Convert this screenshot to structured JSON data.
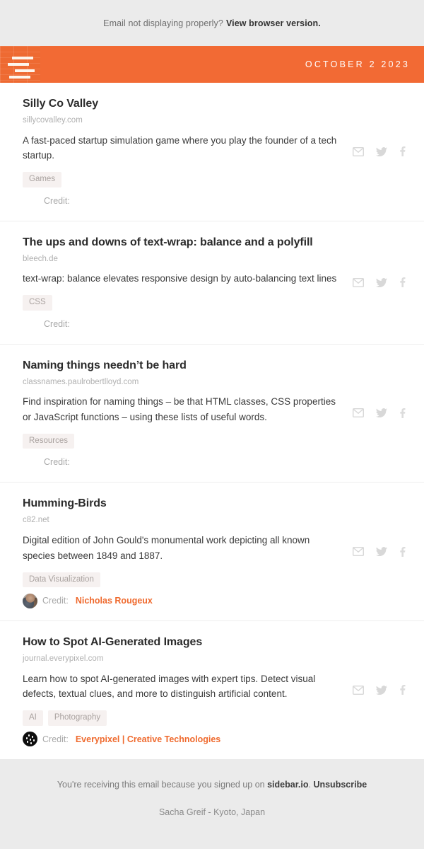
{
  "preheader": {
    "text": "Email not displaying properly?",
    "link_label": "View browser version."
  },
  "masthead": {
    "date": "OCTOBER 2 2023",
    "logo_name": "sidebar-brick-logo",
    "background_color": "#f26a34"
  },
  "social": {
    "email_label": "Share by email",
    "twitter_label": "Share on Twitter",
    "facebook_label": "Share on Facebook"
  },
  "articles": [
    {
      "title": "Silly Co Valley",
      "domain": "sillycovalley.com",
      "description": "A fast-paced startup simulation game where you play the founder of a tech startup.",
      "tags": [
        "Games"
      ],
      "credit_label": "Credit:",
      "credit_name": "",
      "has_avatar": false,
      "avatar_type": ""
    },
    {
      "title": "The ups and downs of text-wrap: balance and a polyfill",
      "domain": "bleech.de",
      "description": "text-wrap: balance elevates responsive design by auto-balancing text lines",
      "tags": [
        "CSS"
      ],
      "credit_label": "Credit:",
      "credit_name": "",
      "has_avatar": false,
      "avatar_type": ""
    },
    {
      "title": "Naming things needn’t be hard",
      "domain": "classnames.paulrobertlloyd.com",
      "description": "Find inspiration for naming things – be that HTML classes, CSS properties or JavaScript functions – using these lists of useful words.",
      "tags": [
        "Resources"
      ],
      "credit_label": "Credit:",
      "credit_name": "",
      "has_avatar": false,
      "avatar_type": ""
    },
    {
      "title": "Humming-Birds",
      "domain": "c82.net",
      "description": "Digital edition of John Gould's monumental work depicting all known species between 1849 and 1887.",
      "tags": [
        "Data Visualization"
      ],
      "credit_label": "Credit:",
      "credit_name": "Nicholas Rougeux",
      "has_avatar": true,
      "avatar_type": "photo"
    },
    {
      "title": "How to Spot AI-Generated Images",
      "domain": "journal.everypixel.com",
      "description": "Learn how to spot AI-generated images with expert tips. Detect visual defects, textual clues, and more to distinguish artificial content.",
      "tags": [
        "AI",
        "Photography"
      ],
      "credit_label": "Credit:",
      "credit_name": "Everypixel | Creative Technologies",
      "has_avatar": true,
      "avatar_type": "dots"
    }
  ],
  "footer": {
    "reason_prefix": "You're receiving this email because you signed up on ",
    "site_name": "sidebar.io",
    "reason_suffix": ".",
    "unsubscribe_label": "Unsubscribe",
    "signature": "Sacha Greif - Kyoto, Japan"
  },
  "colors": {
    "accent": "#ef6a2e",
    "header_orange": "#f26a34",
    "page_background": "#ebebeb",
    "tag_background": "#f6f1f0"
  }
}
